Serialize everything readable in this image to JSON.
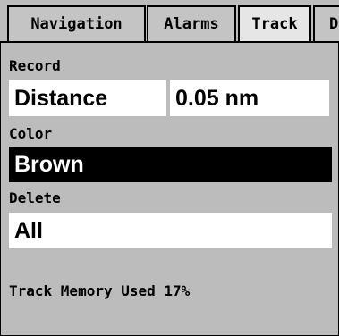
{
  "tabs": [
    {
      "label": "Navigation",
      "active": false
    },
    {
      "label": "Alarms",
      "active": false
    },
    {
      "label": "Track",
      "active": true
    },
    {
      "label": "D",
      "active": false
    }
  ],
  "record": {
    "label": "Record",
    "mode_value": "Distance",
    "interval_value": "0.05 nm"
  },
  "color": {
    "label": "Color",
    "value": "Brown"
  },
  "delete": {
    "label": "Delete",
    "value": "All"
  },
  "status": {
    "memory_text": "Track Memory Used 17%"
  }
}
